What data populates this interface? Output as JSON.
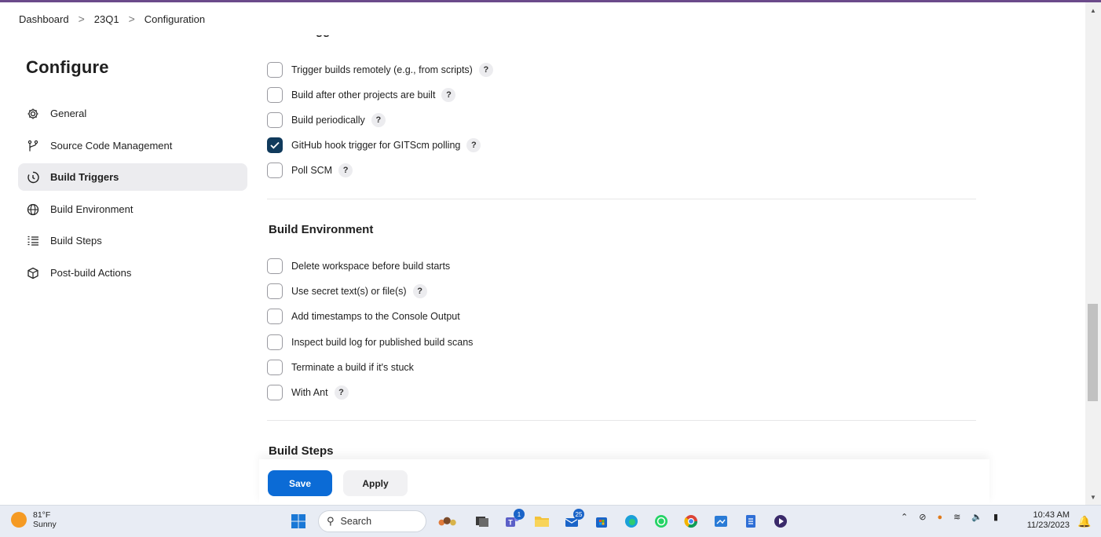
{
  "breadcrumb": [
    "Dashboard",
    "23Q1",
    "Configuration"
  ],
  "sidebar": {
    "title": "Configure",
    "items": [
      {
        "label": "General",
        "icon": "gear-icon"
      },
      {
        "label": "Source Code Management",
        "icon": "branch-icon"
      },
      {
        "label": "Build Triggers",
        "icon": "clock-icon",
        "active": true
      },
      {
        "label": "Build Environment",
        "icon": "globe-icon"
      },
      {
        "label": "Build Steps",
        "icon": "list-icon"
      },
      {
        "label": "Post-build Actions",
        "icon": "package-icon"
      }
    ]
  },
  "sections": {
    "build_triggers": {
      "title": "Build Triggers",
      "options": [
        {
          "label": "Trigger builds remotely (e.g., from scripts)",
          "checked": false,
          "help": "?"
        },
        {
          "label": "Build after other projects are built",
          "checked": false,
          "help": "?"
        },
        {
          "label": "Build periodically",
          "checked": false,
          "help": "?"
        },
        {
          "label": "GitHub hook trigger for GITScm polling",
          "checked": true,
          "help": "?"
        },
        {
          "label": "Poll SCM",
          "checked": false,
          "help": "?"
        }
      ]
    },
    "build_environment": {
      "title": "Build Environment",
      "options": [
        {
          "label": "Delete workspace before build starts",
          "checked": false
        },
        {
          "label": "Use secret text(s) or file(s)",
          "checked": false,
          "help": "?"
        },
        {
          "label": "Add timestamps to the Console Output",
          "checked": false
        },
        {
          "label": "Inspect build log for published build scans",
          "checked": false
        },
        {
          "label": "Terminate a build if it's stuck",
          "checked": false
        },
        {
          "label": "With Ant",
          "checked": false,
          "help": "?"
        }
      ]
    },
    "build_steps": {
      "title": "Build Steps"
    }
  },
  "actions": {
    "save_label": "Save",
    "apply_label": "Apply"
  },
  "taskbar": {
    "weather_temp": "81°F",
    "weather_desc": "Sunny",
    "search_placeholder": "Search",
    "mail_badge": "25",
    "teams_badge": "1",
    "time": "10:43 AM",
    "date": "11/23/2023"
  },
  "colors": {
    "accent": "#0b6bd6",
    "checked": "#103a5c",
    "topstrip": "#6b4a8a"
  }
}
